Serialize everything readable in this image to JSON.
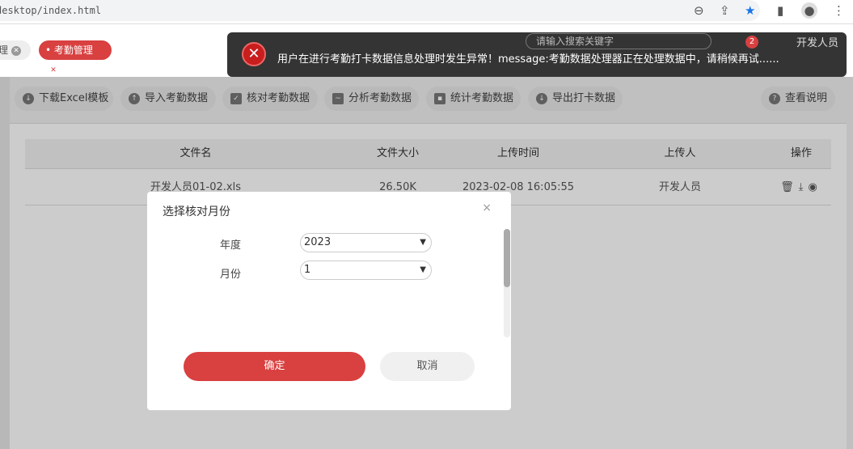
{
  "browser": {
    "url": "desktop/index.html"
  },
  "header": {
    "tabs": [
      {
        "label": "理"
      },
      {
        "label": "考勤管理"
      }
    ],
    "search_placeholder": "请输入搜索关键字",
    "notification_count": "2",
    "user": "开发人员"
  },
  "toast": {
    "message": "用户在进行考勤打卡数据信息处理时发生异常！message:考勤数据处理器正在处理数据中，请稍候再试......"
  },
  "toolbar": [
    {
      "label": "下载Excel模板",
      "icon": "download-icon"
    },
    {
      "label": "导入考勤数据",
      "icon": "upload-icon"
    },
    {
      "label": "核对考勤数据",
      "icon": "clipboard-icon"
    },
    {
      "label": "分析考勤数据",
      "icon": "chart-icon"
    },
    {
      "label": "统计考勤数据",
      "icon": "monitor-icon"
    },
    {
      "label": "导出打卡数据",
      "icon": "download-icon"
    },
    {
      "label": "查看说明",
      "icon": "help-icon"
    }
  ],
  "table": {
    "columns": [
      "文件名",
      "文件大小",
      "上传时间",
      "上传人",
      "操作"
    ],
    "rows": [
      {
        "name": "开发人员01-02.xls",
        "size": "26.50K",
        "time": "2023-02-08 16:05:55",
        "uploader": "开发人员"
      }
    ]
  },
  "dialog": {
    "title": "选择核对月份",
    "close": "×",
    "year_label": "年度",
    "year_value": "2023",
    "month_label": "月份",
    "month_value": "1",
    "ok": "确定",
    "cancel": "取消"
  }
}
